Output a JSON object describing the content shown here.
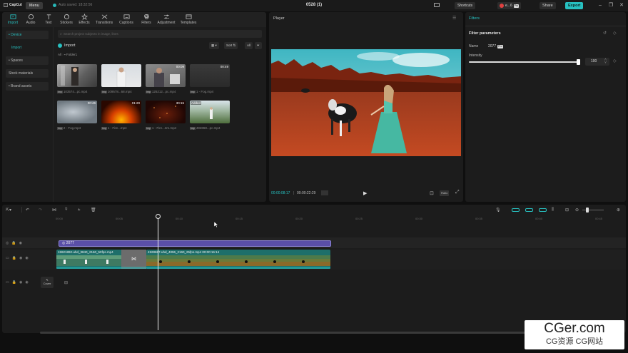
{
  "app": {
    "logo_text": "CapCut",
    "menu_label": "Menu",
    "autosave_text": "Auto saved: 18:32:56",
    "project_title": "0528 (1)",
    "shortcuts_label": "Shortcuts",
    "user_label": "e...6",
    "user_badge": "Pro",
    "share_label": "Share",
    "export_label": "Export"
  },
  "tabs": [
    {
      "label": "Import",
      "icon": "import-icon"
    },
    {
      "label": "Audio",
      "icon": "audio-icon"
    },
    {
      "label": "Text",
      "icon": "text-icon"
    },
    {
      "label": "Stickers",
      "icon": "stickers-icon"
    },
    {
      "label": "Effects",
      "icon": "effects-icon"
    },
    {
      "label": "Transitions",
      "icon": "transitions-icon"
    },
    {
      "label": "Captions",
      "icon": "captions-icon"
    },
    {
      "label": "Filters",
      "icon": "filters-icon"
    },
    {
      "label": "Adjustment",
      "icon": "adjustment-icon"
    },
    {
      "label": "Templates",
      "icon": "templates-icon"
    }
  ],
  "leftnav": {
    "device": "• Device",
    "import": "Import",
    "spaces": "• Spaces",
    "stock": "Stock materials",
    "brand": "• Brand assets"
  },
  "media": {
    "search_placeholder": "Search project subjects in image, lines",
    "import_label": "Import",
    "sort_label": "Sort",
    "all_label": "All",
    "breadcrumb_root": "All",
    "breadcrumb_folder": "Folder1",
    "file_tag": "Added",
    "items": [
      {
        "name": "103574...pc.mp4",
        "duration": ""
      },
      {
        "name": "109578...68.mp4",
        "duration": ""
      },
      {
        "name": "125212...pc.mp4",
        "duration": "00:09"
      },
      {
        "name": "1 - Fog.mp4",
        "duration": "00:49"
      },
      {
        "name": "2 - Fog.mp4",
        "duration": "00:46"
      },
      {
        "name": "1 - Fire...mp4",
        "duration": "01:20"
      },
      {
        "name": "1 - Fire...3m.mp4",
        "duration": "30:15"
      },
      {
        "name": "492868...pc.mp4",
        "duration": "",
        "added": "Added"
      }
    ]
  },
  "player": {
    "label": "Player",
    "time_current": "00:00:08:17",
    "time_total": "00:00:22:29",
    "ratio_label": "Ratio"
  },
  "filters": {
    "title": "Filters",
    "params_title": "Filter parameters",
    "name_label": "Name",
    "name_value": "2077",
    "name_badge": "Pro",
    "intensity_label": "Intensity",
    "intensity_value": "100",
    "intensity_level": 1.0
  },
  "timeline": {
    "ticks": [
      "00:00",
      "00:05",
      "00:10",
      "00:15",
      "00:20",
      "00:25",
      "00:30",
      "00:35",
      "00:40",
      "00:45"
    ],
    "filter_clip": "2077",
    "clip1_label": "15921892-uhd_3840_2160_50fps.mp4",
    "clip2_label": "4928687-uhd_4096_2160_25fps.mp4  00:00:16:14",
    "cover_label": "Cover"
  },
  "watermark": {
    "big": "CGer.com",
    "small": "CG资源  CG网站"
  }
}
